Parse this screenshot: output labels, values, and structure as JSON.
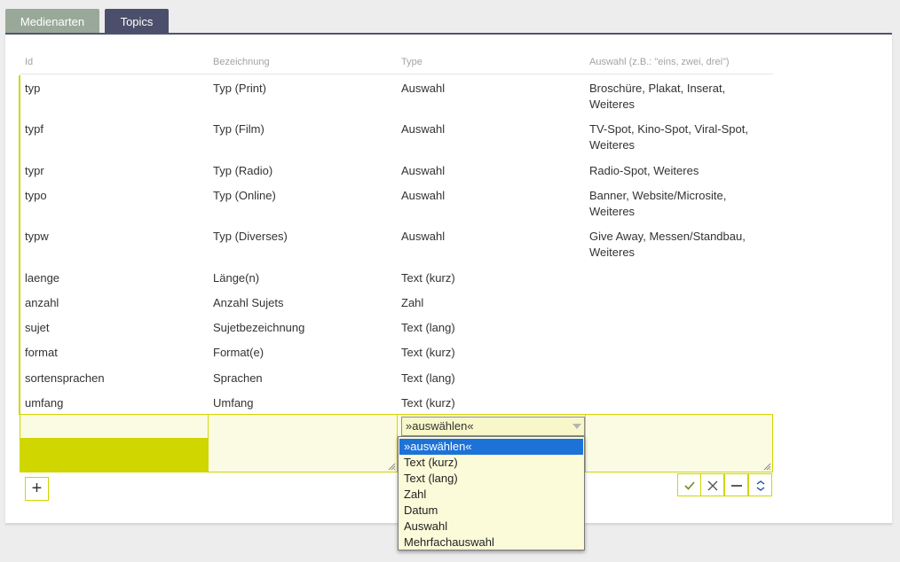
{
  "tabs": [
    {
      "label": "Medienarten",
      "active": false
    },
    {
      "label": "Topics",
      "active": true
    }
  ],
  "table": {
    "headers": {
      "id": "Id",
      "bezeichnung": "Bezeichnung",
      "type": "Type",
      "auswahl": "Auswahl (z.B.: \"eins, zwei, drei\")"
    },
    "rows": [
      {
        "id": "typ",
        "bezeichnung": "Typ (Print)",
        "type": "Auswahl",
        "auswahl_1": "Broschüre, Plakat, Inserat,",
        "auswahl_2": "Weiteres"
      },
      {
        "id": "typf",
        "bezeichnung": "Typ (Film)",
        "type": "Auswahl",
        "auswahl_1": "TV-Spot, Kino-Spot, Viral-Spot,",
        "auswahl_2": "Weiteres"
      },
      {
        "id": "typr",
        "bezeichnung": "Typ (Radio)",
        "type": "Auswahl",
        "auswahl_1": "Radio-Spot, Weiteres",
        "auswahl_2": ""
      },
      {
        "id": "typo",
        "bezeichnung": "Typ (Online)",
        "type": "Auswahl",
        "auswahl_1": "Banner, Website/Microsite,",
        "auswahl_2": "Weiteres"
      },
      {
        "id": "typw",
        "bezeichnung": "Typ (Diverses)",
        "type": "Auswahl",
        "auswahl_1": "Give Away, Messen/Standbau,",
        "auswahl_2": "Weiteres"
      },
      {
        "id": "laenge",
        "bezeichnung": "Länge(n)",
        "type": "Text (kurz)",
        "auswahl_1": "",
        "auswahl_2": ""
      },
      {
        "id": "anzahl",
        "bezeichnung": "Anzahl Sujets",
        "type": "Zahl",
        "auswahl_1": "",
        "auswahl_2": ""
      },
      {
        "id": "sujet",
        "bezeichnung": "Sujetbezeichnung",
        "type": "Text (lang)",
        "auswahl_1": "",
        "auswahl_2": ""
      },
      {
        "id": "format",
        "bezeichnung": "Format(e)",
        "type": "Text (kurz)",
        "auswahl_1": "",
        "auswahl_2": ""
      },
      {
        "id": "sortensprachen",
        "bezeichnung": "Sprachen",
        "type": "Text (lang)",
        "auswahl_1": "",
        "auswahl_2": ""
      },
      {
        "id": "umfang",
        "bezeichnung": "Umfang",
        "type": "Text (kurz)",
        "auswahl_1": "",
        "auswahl_2": ""
      }
    ]
  },
  "new_row": {
    "id_value": "",
    "bezeichnung_value": "",
    "type_selected": "»auswählen«",
    "auswahl_value": ""
  },
  "type_options": [
    "»auswählen«",
    "Text (kurz)",
    "Text (lang)",
    "Zahl",
    "Datum",
    "Auswahl",
    "Mehrfachauswahl"
  ],
  "actions": {
    "add_label": "+",
    "icons": [
      "check-icon",
      "close-icon",
      "minus-icon",
      "collapse-icon"
    ]
  },
  "colors": {
    "accent": "#cfd600",
    "tab_active": "#4c4f6b",
    "tab_inactive": "#9aa89a",
    "selection": "#1d72d8",
    "field_bg": "#fbfbe3"
  }
}
